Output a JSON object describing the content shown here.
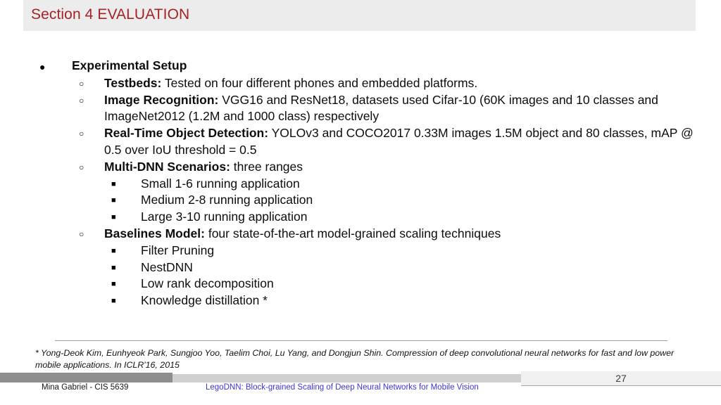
{
  "header": {
    "title": "Section 4 EVALUATION",
    "title_color": "#a52226",
    "band_color": "#ececec"
  },
  "content": {
    "section_heading": "Experimental Setup",
    "items": [
      {
        "lead": "Testbeds:",
        "rest": " Tested on four  different phones and embedded platforms."
      },
      {
        "lead": "Image Recognition:",
        "rest": " VGG16 and ResNet18, datasets used Cifar-10 (60K images and 10 classes and ImageNet2012 (1.2M and 1000 class) respectively"
      },
      {
        "lead": "Real-Time Object Detection:",
        "rest": " YOLOv3 and COCO2017 0.33M images 1.5M object and 80 classes, mAP @ 0.5 over IoU threshold = 0.5"
      },
      {
        "lead": "Multi-DNN Scenarios:",
        "rest": " three ranges",
        "subitems": [
          "Small 1-6 running application",
          "Medium 2-8 running application",
          "Large 3-10 running application"
        ]
      },
      {
        "lead": "Baselines Model:",
        "rest": " four state-of-the-art model-grained scaling techniques",
        "subitems": [
          "Filter Pruning",
          "NestDNN",
          "Low rank decomposition",
          "Knowledge distillation *"
        ]
      }
    ],
    "bullet_level1": "●",
    "bullet_level2": "○",
    "bullet_level3": "■"
  },
  "footnote": {
    "text": "*  Yong-Deok Kim, Eunhyeok Park, Sungjoo Yoo, Taelim Choi, Lu Yang, and Dongjun Shin. Compression of deep convolutional neural networks for fast and low power mobile applications. In ICLR'16, 2015"
  },
  "footer": {
    "author": "Mina Gabriel - CIS  5639",
    "paper_reference": "LegoDNN: Block-grained Scaling of Deep Neural Networks for Mobile Vision",
    "paper_reference_color": "#3b35d6",
    "page_number": "27"
  }
}
